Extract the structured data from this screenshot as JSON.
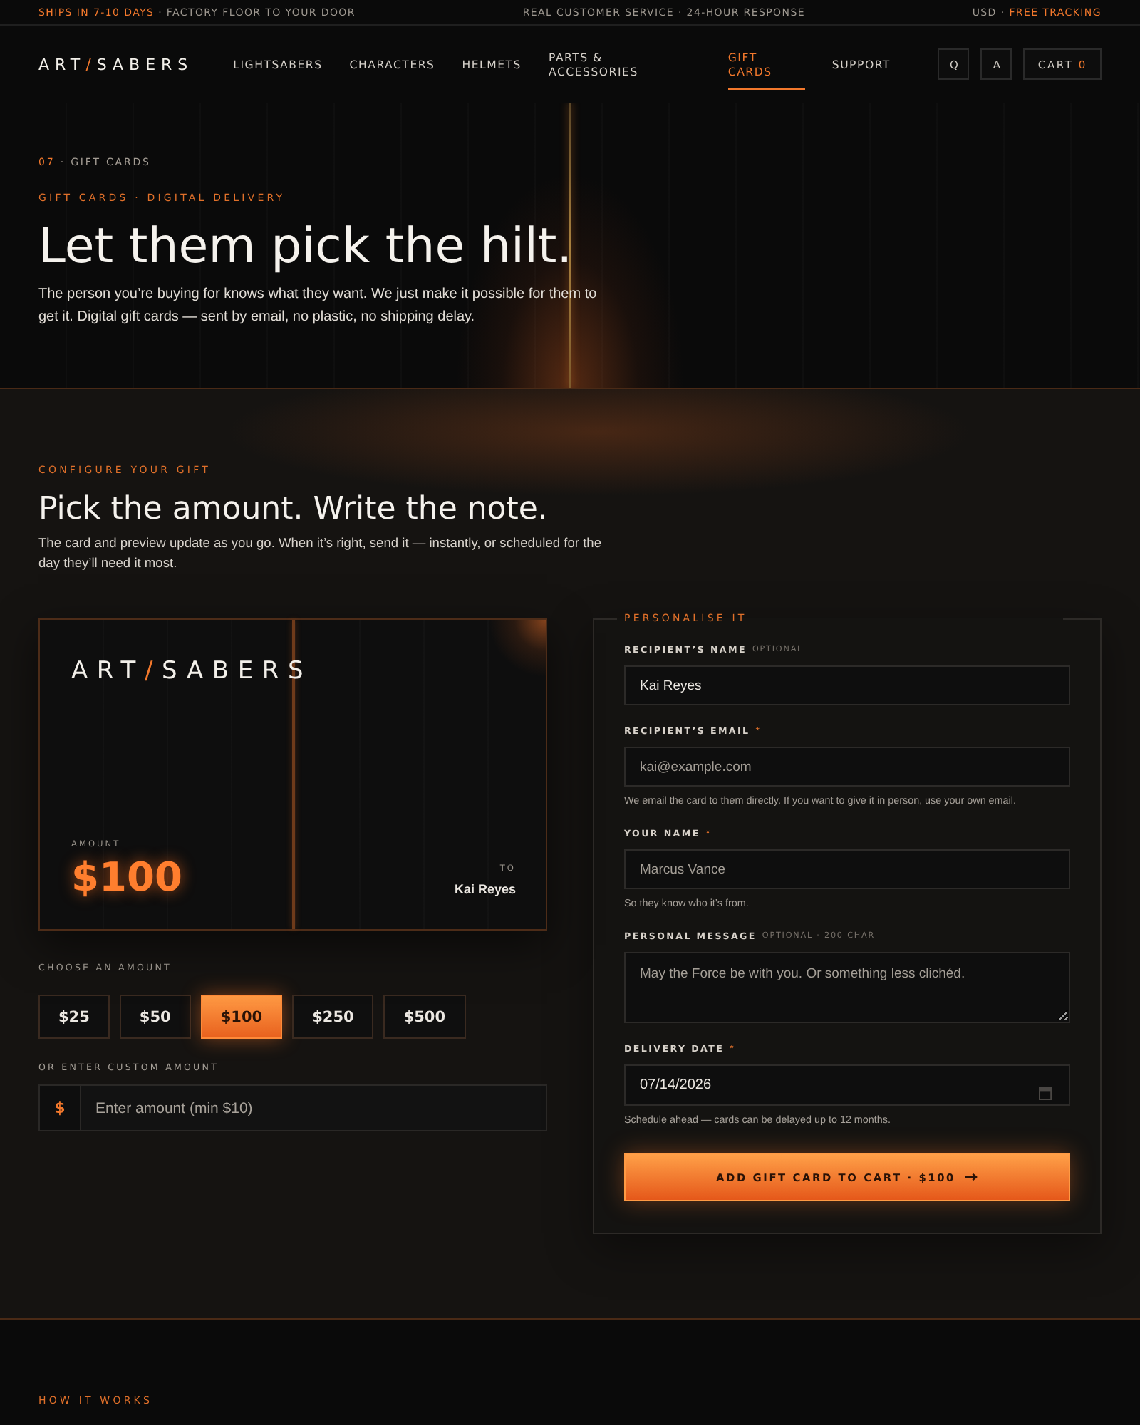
{
  "top_bar": {
    "left": {
      "accent": "SHIPS IN 7-10 DAYS",
      "trail": "· FACTORY FLOOR TO YOUR DOOR"
    },
    "center": {
      "lead": "REAL CUSTOMER SERVICE · 24-HOUR RESPONSE"
    },
    "right": {
      "lead": "USD ·",
      "accent": "FREE TRACKING"
    }
  },
  "nav": {
    "logo": {
      "lead": "ART",
      "accent": "/",
      "trail": "SABERS"
    },
    "links": [
      {
        "label": "LIGHTSABERS",
        "selected": false
      },
      {
        "label": "CHARACTERS",
        "selected": false
      },
      {
        "label": "HELMETS",
        "selected": false
      },
      {
        "label": "PARTS & ACCESSORIES",
        "selected": false
      },
      {
        "label": "GIFT CARDS",
        "selected": true
      },
      {
        "label": "SUPPORT",
        "selected": false
      }
    ],
    "search": "Q",
    "account": "A",
    "cart": {
      "lead": "CART",
      "accent": "0"
    }
  },
  "hero": {
    "breadcrumb": {
      "accent": "07",
      "trail": "· GIFT CARDS"
    },
    "eyebrow": "GIFT CARDS · DIGITAL DELIVERY",
    "title": "Let them pick the hilt.",
    "text": "The person you’re buying for knows what they want. We just make it possible for them to get it. Digital gift cards — sent by email, no plastic, no shipping delay."
  },
  "configure": {
    "eyebrow": "CONFIGURE YOUR GIFT",
    "title": "Pick the amount. Write the note.",
    "text": "The card and preview update as you go. When it’s right, send it — instantly, or scheduled for the day they’ll need it most."
  },
  "gift_card": {
    "logo": {
      "lead": "ART",
      "accent": "/",
      "trail": "SABERS"
    },
    "amount_label": "AMOUNT",
    "amount": "$100",
    "to_label": "TO",
    "to_name": "Kai Reyes"
  },
  "amounts": {
    "label": "CHOOSE AN AMOUNT",
    "options": [
      {
        "label": "$25",
        "selected": false
      },
      {
        "label": "$50",
        "selected": false
      },
      {
        "label": "$100",
        "selected": true
      },
      {
        "label": "$250",
        "selected": false
      },
      {
        "label": "$500",
        "selected": false
      }
    ]
  },
  "custom_amount": {
    "label": "OR ENTER CUSTOM AMOUNT",
    "prefix": "$",
    "placeholder": "Enter amount (min $10)"
  },
  "personalise": {
    "legend": "PERSONALISE IT",
    "fields": [
      {
        "kind": "text",
        "label": "RECIPIENT’S NAME",
        "note": "OPTIONAL",
        "value": "Kai Reyes"
      },
      {
        "kind": "text",
        "label": "RECIPIENT’S EMAIL",
        "mark": "*",
        "placeholder": "kai@example.com",
        "help": "We email the card to them directly. If you want to give it in person, use your own email."
      },
      {
        "kind": "text",
        "label": "YOUR NAME",
        "mark": "*",
        "placeholder": "Marcus Vance",
        "help": "So they know who it’s from."
      },
      {
        "kind": "textarea",
        "label": "PERSONAL MESSAGE",
        "note": "OPTIONAL · 200 CHAR",
        "placeholder": "May the Force be with you. Or something less clichéd."
      },
      {
        "kind": "date",
        "label": "DELIVERY DATE",
        "mark": "*",
        "value": "07/14/2026",
        "help": "Schedule ahead — cards can be delayed up to 12 months."
      }
    ],
    "submit": "ADD GIFT CARD TO CART · $100"
  },
  "how_it_works": {
    "eyebrow": "HOW IT WORKS"
  }
}
